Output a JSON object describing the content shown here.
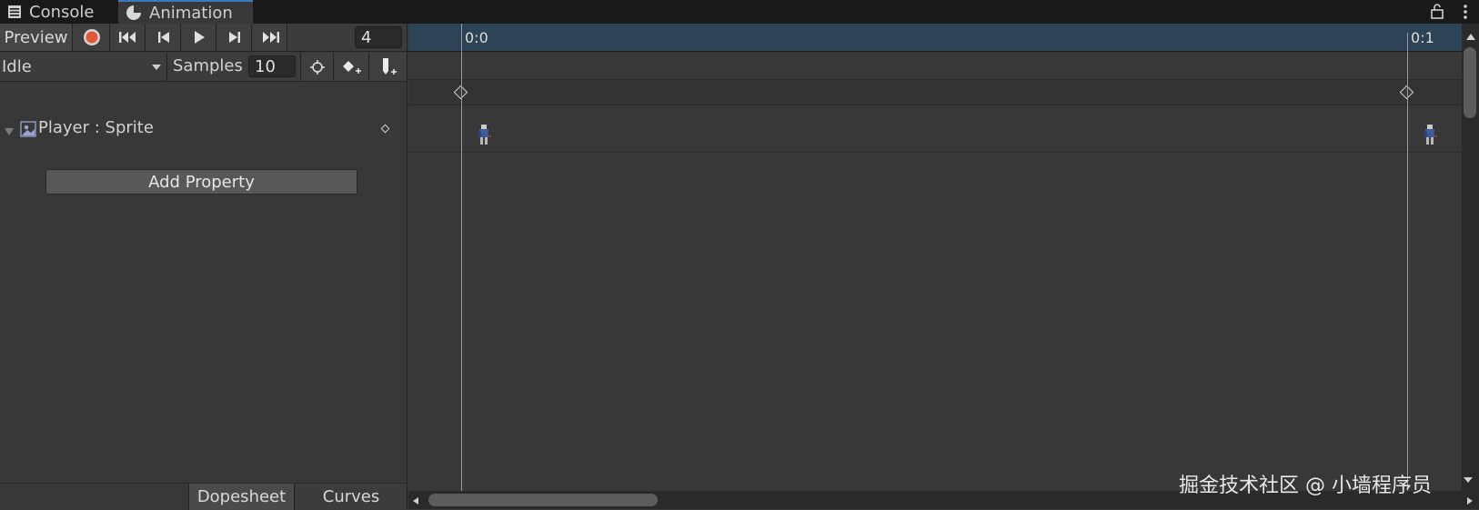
{
  "tabs": [
    {
      "label": "Console",
      "icon": "console-icon"
    },
    {
      "label": "Animation",
      "icon": "animation-clock-icon"
    }
  ],
  "toolbar": {
    "preview_label": "Preview",
    "frame_value": "4",
    "clip_name": "Idle",
    "samples_label": "Samples",
    "samples_value": "10"
  },
  "properties": [
    {
      "label": "Player : Sprite",
      "icon": "sprite-renderer-icon"
    }
  ],
  "add_property_label": "Add Property",
  "bottom_tabs": [
    "Dopesheet",
    "Curves"
  ],
  "ruler": {
    "start_label": "0:0",
    "end_label": "0:1"
  },
  "watermark": "掘金技术社区 @ 小墙程序员",
  "colors": {
    "record": "#e0593a",
    "ruler_bg": "#2c4456",
    "tab_accent": "#3a79bb"
  }
}
